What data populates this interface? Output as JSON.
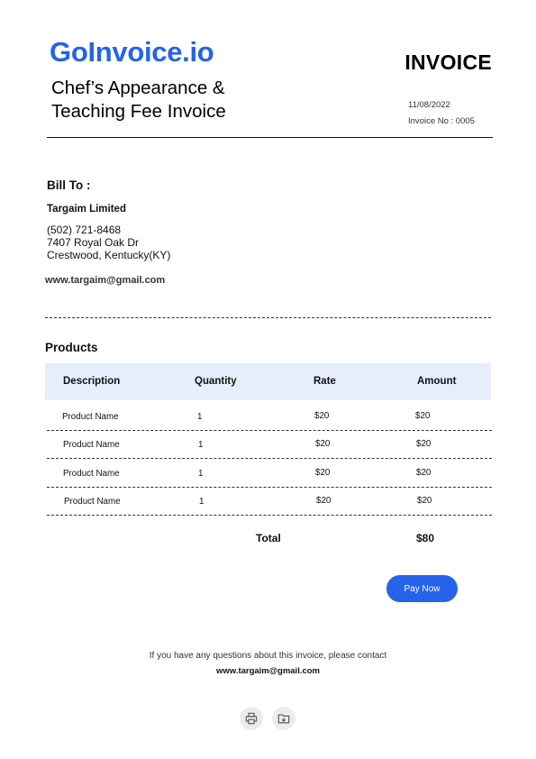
{
  "brand": {
    "name": "GoInvoice.io",
    "color": "#2563eb"
  },
  "doc": {
    "type": "INVOICE",
    "title_line1": "Chef’s Appearance &",
    "title_line2": "Teaching Fee Invoice",
    "date": "11/08/2022",
    "invoice_no": "Invoice No : 0005"
  },
  "bill_to": {
    "heading": "Bill To :",
    "name": "Targaim Limited",
    "phone": "(502) 721-8468",
    "address_line1": "7407 Royal Oak Dr",
    "address_line2": "Crestwood, Kentucky(KY)",
    "email": "www.targaim@gmail.com"
  },
  "products": {
    "heading": "Products",
    "columns": [
      "Description",
      "Quantity",
      "Rate",
      "Amount"
    ],
    "rows": [
      [
        "Product  Name",
        "1",
        "$20",
        "$20"
      ],
      [
        "Product  Name",
        "1",
        "$20",
        "$20"
      ],
      [
        "Product  Name",
        "1",
        "$20",
        "$20"
      ],
      [
        "Product  Name",
        "1",
        "$20",
        "$20"
      ]
    ],
    "header_bg": "#e6edfb"
  },
  "totals": {
    "label": "Total",
    "value": "$80"
  },
  "actions": {
    "pay_label": "Pay Now"
  },
  "footer": {
    "message": "If you have any questions about this invoice, please contact",
    "email": "www.targaim@gmail.com",
    "icons": [
      "printer-icon",
      "folder-download-icon"
    ]
  }
}
